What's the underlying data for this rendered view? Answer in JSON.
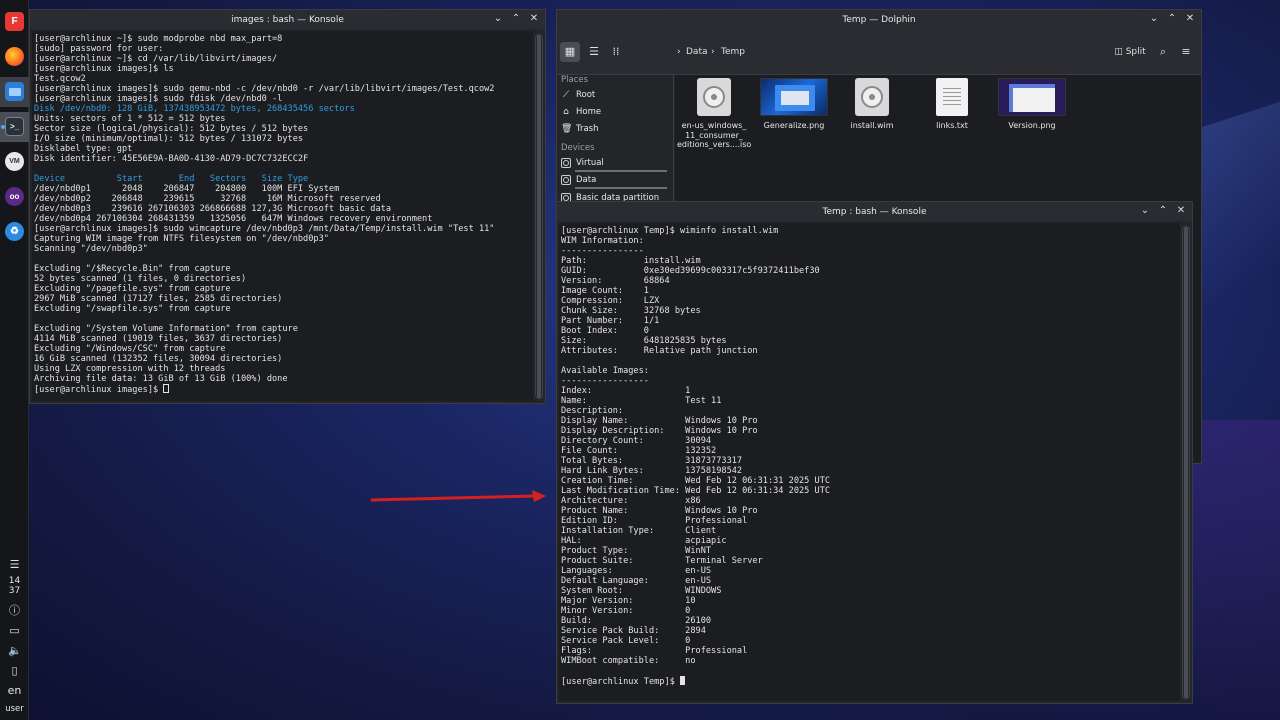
{
  "panel": {
    "clock_hours": "14",
    "clock_minutes": "37",
    "keyboard_layout": "en",
    "user": "user"
  },
  "konsole_left": {
    "title": "images : bash — Konsole",
    "lines": [
      {
        "t": "[user@archlinux ~]$ sudo modprobe nbd max_part=8",
        "c": ""
      },
      {
        "t": "[sudo] password for user:",
        "c": ""
      },
      {
        "t": "[user@archlinux ~]$ cd /var/lib/libvirt/images/",
        "c": ""
      },
      {
        "t": "[user@archlinux images]$ ls",
        "c": ""
      },
      {
        "t": "Test.qcow2",
        "c": ""
      },
      {
        "t": "[user@archlinux images]$ sudo qemu-nbd -c /dev/nbd0 -r /var/lib/libvirt/images/Test.qcow2",
        "c": ""
      },
      {
        "t": "[user@archlinux images]$ sudo fdisk /dev/nbd0 -l",
        "c": ""
      },
      {
        "t": "Disk /dev/nbd0: 128 GiB, 137438953472 bytes, 268435456 sectors",
        "c": "blue"
      },
      {
        "t": "Units: sectors of 1 * 512 = 512 bytes",
        "c": ""
      },
      {
        "t": "Sector size (logical/physical): 512 bytes / 512 bytes",
        "c": ""
      },
      {
        "t": "I/O size (minimum/optimal): 512 bytes / 131072 bytes",
        "c": ""
      },
      {
        "t": "Disklabel type: gpt",
        "c": ""
      },
      {
        "t": "Disk identifier: 45E56E9A-BA0D-4130-AD79-DC7C732ECC2F",
        "c": ""
      },
      {
        "t": "",
        "c": ""
      },
      {
        "t": "Device          Start       End   Sectors   Size Type",
        "c": "blue"
      },
      {
        "t": "/dev/nbd0p1      2048    206847    204800   100M EFI System",
        "c": ""
      },
      {
        "t": "/dev/nbd0p2    206848    239615     32768    16M Microsoft reserved",
        "c": ""
      },
      {
        "t": "/dev/nbd0p3    239616 267106303 266866688 127,3G Microsoft basic data",
        "c": ""
      },
      {
        "t": "/dev/nbd0p4 267106304 268431359   1325056   647M Windows recovery environment",
        "c": ""
      },
      {
        "t": "[user@archlinux images]$ sudo wimcapture /dev/nbd0p3 /mnt/Data/Temp/install.wim \"Test 11\"",
        "c": ""
      },
      {
        "t": "Capturing WIM image from NTFS filesystem on \"/dev/nbd0p3\"",
        "c": ""
      },
      {
        "t": "Scanning \"/dev/nbd0p3\"",
        "c": ""
      },
      {
        "t": "",
        "c": ""
      },
      {
        "t": "Excluding \"/$Recycle.Bin\" from capture",
        "c": ""
      },
      {
        "t": "52 bytes scanned (1 files, 0 directories)",
        "c": ""
      },
      {
        "t": "Excluding \"/pagefile.sys\" from capture",
        "c": ""
      },
      {
        "t": "2967 MiB scanned (17127 files, 2585 directories)",
        "c": ""
      },
      {
        "t": "Excluding \"/swapfile.sys\" from capture",
        "c": ""
      },
      {
        "t": "",
        "c": ""
      },
      {
        "t": "Excluding \"/System Volume Information\" from capture",
        "c": ""
      },
      {
        "t": "4114 MiB scanned (19019 files, 3637 directories)",
        "c": ""
      },
      {
        "t": "Excluding \"/Windows/CSC\" from capture",
        "c": ""
      },
      {
        "t": "16 GiB scanned (132352 files, 30094 directories)",
        "c": ""
      },
      {
        "t": "Using LZX compression with 12 threads",
        "c": ""
      },
      {
        "t": "Archiving file data: 13 GiB of 13 GiB (100%) done",
        "c": ""
      }
    ],
    "prompt": "[user@archlinux images]$ "
  },
  "dolphin": {
    "title": "Temp — Dolphin",
    "breadcrumb": [
      "Data",
      "Temp"
    ],
    "split_label": "Split",
    "places_heading": "Places",
    "places": [
      "Root",
      "Home",
      "Trash"
    ],
    "devices_heading": "Devices",
    "devices": [
      "Virtual",
      "Data",
      "Basic data partition"
    ],
    "files": [
      {
        "name": "en-us_windows_\n11_consumer_\neditions_vers....iso",
        "kind": "disc"
      },
      {
        "name": "Generalize.png",
        "kind": "image1"
      },
      {
        "name": "install.wim",
        "kind": "disc"
      },
      {
        "name": "links.txt",
        "kind": "text"
      },
      {
        "name": "Version.png",
        "kind": "image2"
      }
    ]
  },
  "konsole_right": {
    "title": "Temp : bash — Konsole",
    "lines": [
      "[user@archlinux Temp]$ wiminfo install.wim",
      "WIM Information:",
      "----------------",
      "Path:           install.wim",
      "GUID:           0xe30ed39699c003317c5f9372411bef30",
      "Version:        68864",
      "Image Count:    1",
      "Compression:    LZX",
      "Chunk Size:     32768 bytes",
      "Part Number:    1/1",
      "Boot Index:     0",
      "Size:           6481825835 bytes",
      "Attributes:     Relative path junction",
      "",
      "Available Images:",
      "-----------------",
      "Index:                  1",
      "Name:                   Test 11",
      "Description:",
      "Display Name:           Windows 10 Pro",
      "Display Description:    Windows 10 Pro",
      "Directory Count:        30094",
      "File Count:             132352",
      "Total Bytes:            31873773317",
      "Hard Link Bytes:        13758198542",
      "Creation Time:          Wed Feb 12 06:31:31 2025 UTC",
      "Last Modification Time: Wed Feb 12 06:31:34 2025 UTC",
      "Architecture:           x86",
      "Product Name:           Windows 10 Pro",
      "Edition ID:             Professional",
      "Installation Type:      Client",
      "HAL:                    acpiapic",
      "Product Type:           WinNT",
      "Product Suite:          Terminal Server",
      "Languages:              en-US",
      "Default Language:       en-US",
      "System Root:            WINDOWS",
      "Major Version:          10",
      "Minor Version:          0",
      "Build:                  26100",
      "Service Pack Build:     2894",
      "Service Pack Level:     0",
      "Flags:                  Professional",
      "WIMBoot compatible:     no",
      ""
    ],
    "prompt": "[user@archlinux Temp]$ "
  },
  "colors": {
    "accent_blue": "#2f9ee0",
    "arrow_red": "#d61f1f"
  }
}
